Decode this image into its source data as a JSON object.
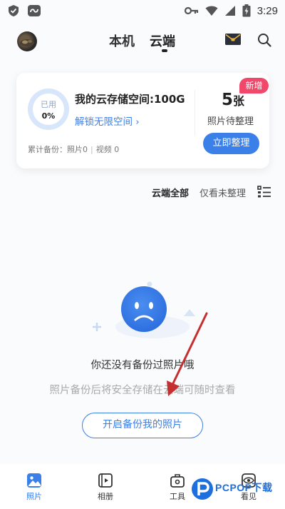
{
  "status_bar": {
    "time": "3:29",
    "icons": [
      "shield-check-icon",
      "network-cloud-icon",
      "key-icon",
      "wifi-icon",
      "signal-icon",
      "battery-charging-icon"
    ]
  },
  "header": {
    "tabs": [
      {
        "label": "本机",
        "active": false
      },
      {
        "label": "云端",
        "active": true
      }
    ],
    "icons": [
      "avatar",
      "mail-envelope-icon",
      "search-icon"
    ]
  },
  "storage_card": {
    "ring_used_label": "已用",
    "ring_used_percent": "0%",
    "title": "我的云存储空间:100G",
    "unlock_link": "解锁无限空间 ›",
    "stats_backup": "累计备份：照片0",
    "stats_video": "视频 0",
    "badge": "新增",
    "pending_count": "5",
    "pending_unit": "张",
    "pending_label": "照片待整理",
    "organize_button": "立即整理"
  },
  "filter": {
    "all_label": "云端全部",
    "unorganized_label": "仅看未整理"
  },
  "empty_state": {
    "title": "你还没有备份过照片哦",
    "description": "照片备份后将安全存储在云端可随时查看",
    "button": "开启备份我的照片"
  },
  "bottom_nav": [
    {
      "label": "照片",
      "icon": "photo-icon",
      "active": true
    },
    {
      "label": "相册",
      "icon": "album-icon",
      "active": false
    },
    {
      "label": "工具",
      "icon": "toolbox-icon",
      "active": false
    },
    {
      "label": "看见",
      "icon": "eye-icon",
      "active": false
    }
  ],
  "watermark": {
    "text": "PCPOP下载"
  },
  "colors": {
    "accent": "#3b7fe8",
    "badge": "#f0476a",
    "arrow": "#c62f2f"
  }
}
